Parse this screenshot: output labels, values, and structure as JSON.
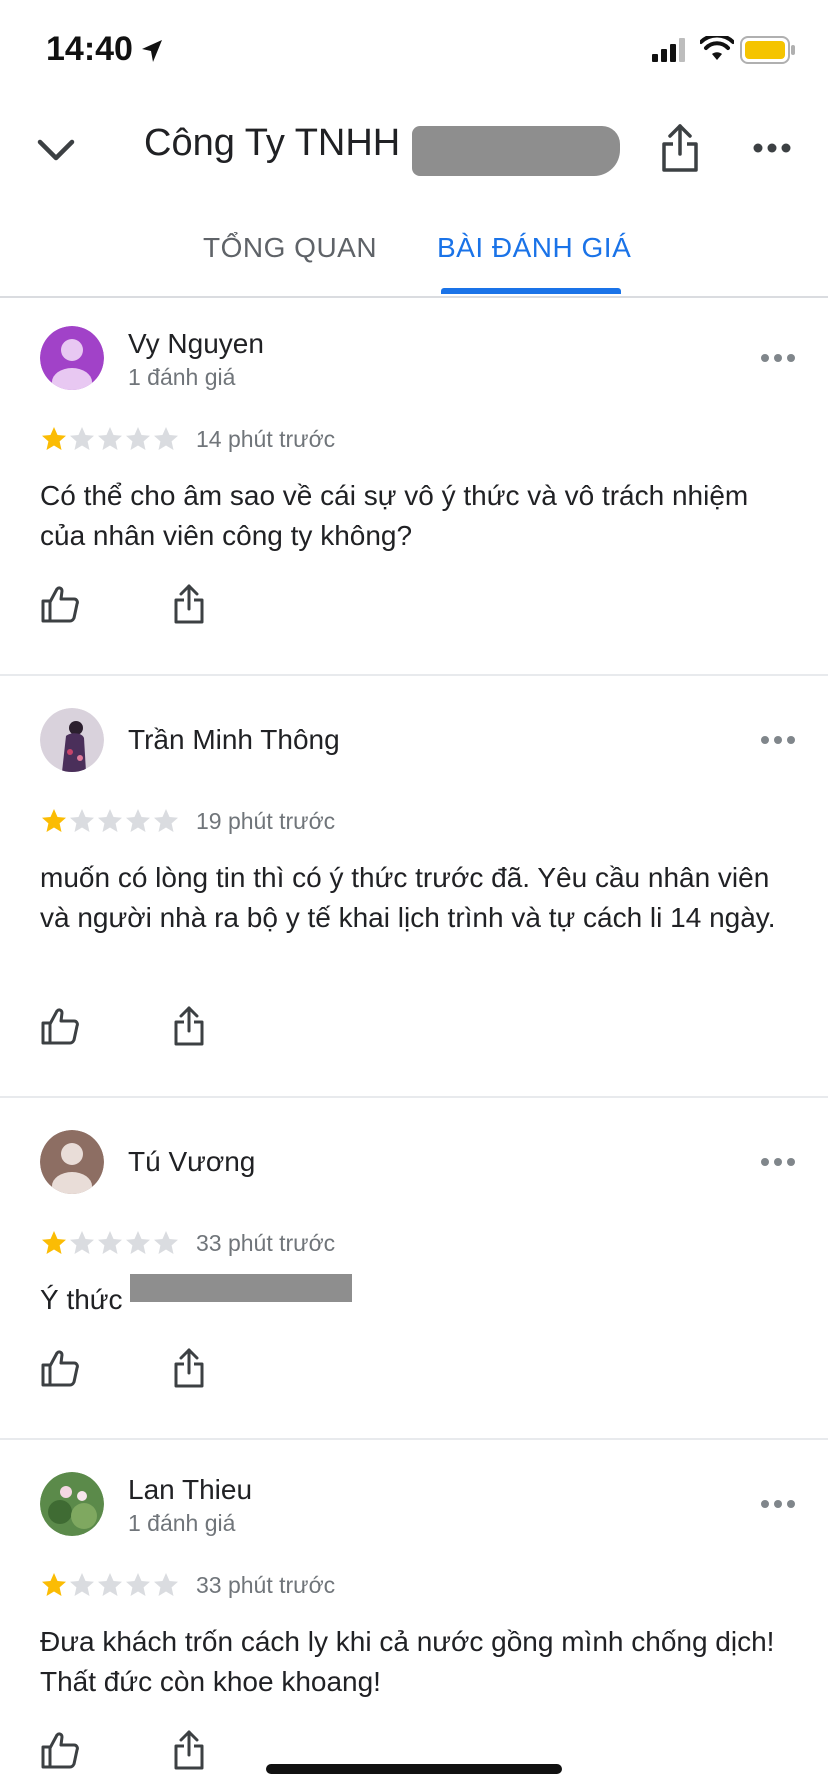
{
  "status_bar": {
    "time": "14:40"
  },
  "header": {
    "title": "Công Ty TNHH"
  },
  "tabs": [
    {
      "label": "TỔNG QUAN",
      "active": false
    },
    {
      "label": "BÀI ĐÁNH GIÁ",
      "active": true
    }
  ],
  "reviews": [
    {
      "name": "Vy Nguyen",
      "review_count": "1 đánh giá",
      "rating": 1,
      "time": "14 phút trước",
      "text": "Có thể cho âm sao về cái sự vô ý thức và vô trách nhiệm của nhân viên công ty không?",
      "avatar_color": "#a142c8"
    },
    {
      "name": "Trần Minh Thông",
      "review_count": "",
      "rating": 1,
      "time": "19 phút trước",
      "text": "muốn có lòng tin thì có ý thức trước đã. Yêu cầu nhân viên và người nhà ra bộ y tế khai lịch trình và tự cách li 14 ngày.",
      "avatar_color": "#d9d2dc"
    },
    {
      "name": "Tú Vương",
      "review_count": "",
      "rating": 1,
      "time": "33 phút trước",
      "text": "Ý thức",
      "avatar_color": "#8d6e63"
    },
    {
      "name": "Lan Thieu",
      "review_count": "1 đánh giá",
      "rating": 1,
      "time": "33 phút trước",
      "text": "Đưa khách trốn cách ly khi cả nước gồng mình chống dịch! Thất đức còn khoe khoang!",
      "avatar_color": "#5b8a4a"
    }
  ],
  "colors": {
    "accent": "#1a73e8",
    "star_filled": "#fbbc04",
    "star_empty": "#dadce0",
    "secondary_text": "#70757a"
  }
}
